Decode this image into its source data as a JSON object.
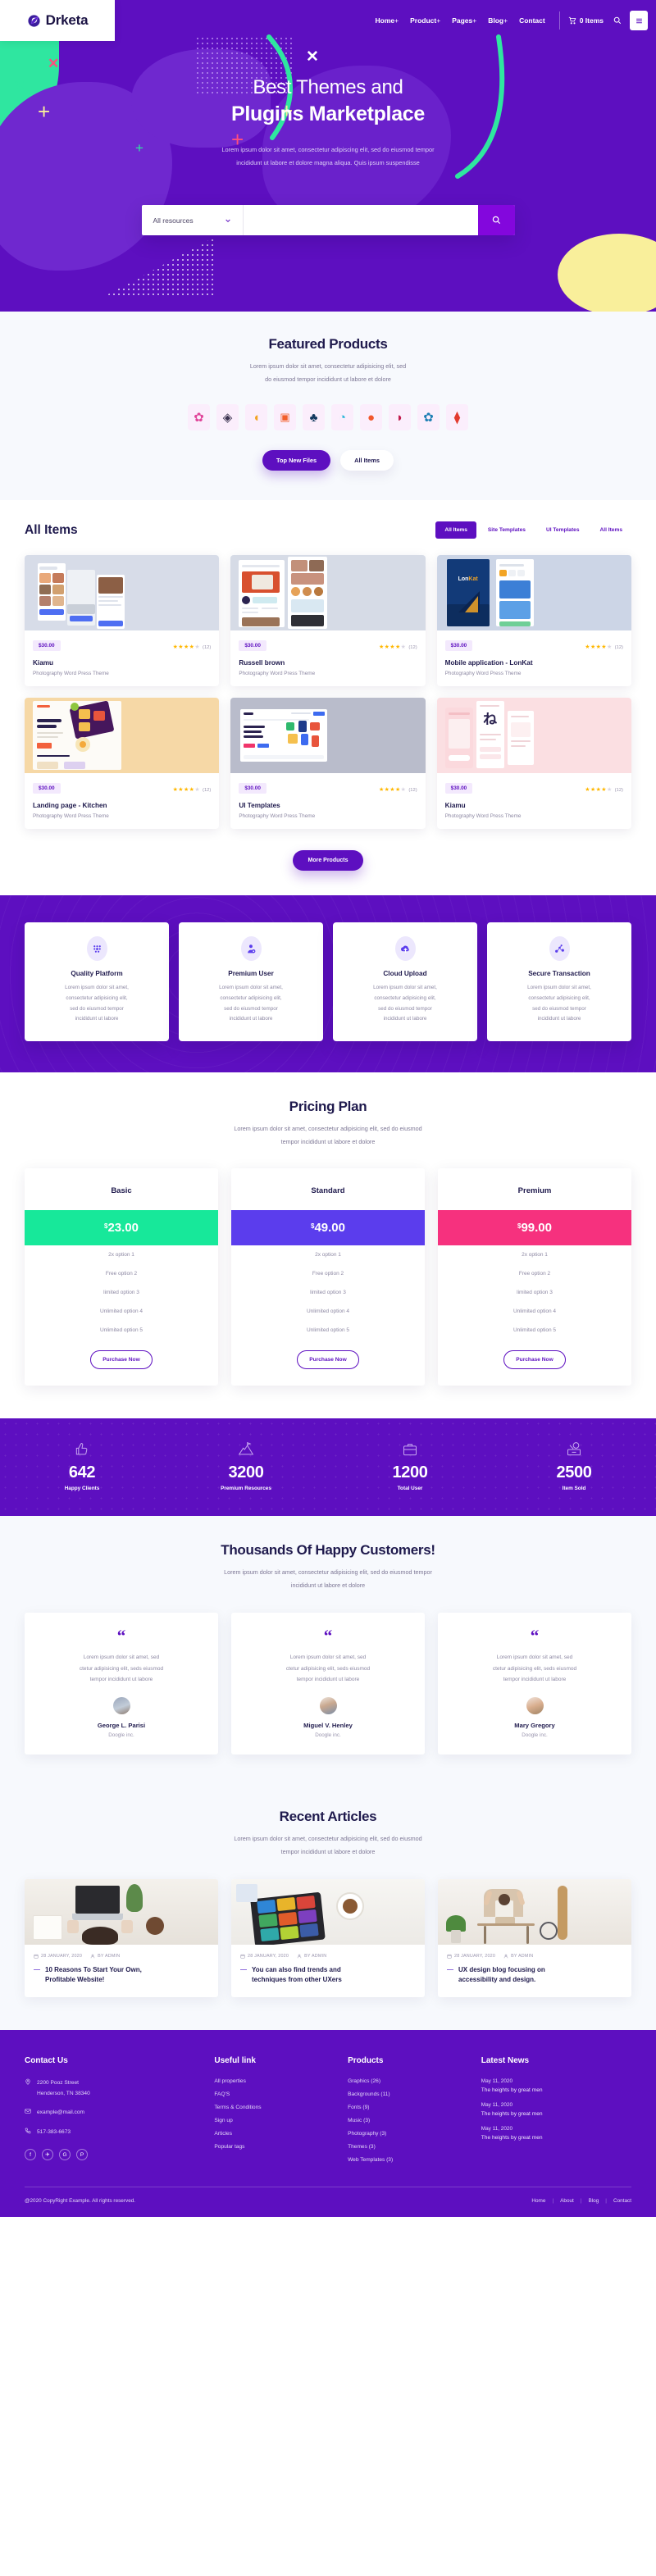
{
  "brand": {
    "name": "Drketa",
    "logo_icon": "leaf-logo-icon"
  },
  "nav": {
    "items": [
      {
        "label": "Home",
        "plus": "+"
      },
      {
        "label": "Product",
        "plus": "+"
      },
      {
        "label": "Pages",
        "plus": "+"
      },
      {
        "label": "Blog",
        "plus": "+"
      },
      {
        "label": "Contact",
        "plus": ""
      }
    ],
    "cart_label": "0 Items",
    "cart_icon": "cart-icon",
    "search_icon": "search-icon",
    "menu_icon": "hamburger-menu-icon"
  },
  "hero": {
    "title_line1": "Best Themes and",
    "title_line2": "Plugins Marketplace",
    "subtitle_line1": "Lorem ipsum dolor sit amet, consectetur adipiscing elit, sed do eiusmod tempor",
    "subtitle_line2": "incididunt ut labore et dolore magna aliqua. Quis ipsum suspendisse",
    "search_select": "All resources",
    "search_placeholder": "",
    "search_value": "",
    "search_button_icon": "search-icon",
    "bg_color": "#5d0fc0"
  },
  "featured": {
    "title": "Featured Products",
    "sub_line1": "Lorem ipsum dolor sit amet, consectetur adipisicing elit, sed",
    "sub_line2": "do eiusmod tempor incididunt ut labore et dolore",
    "brands": [
      {
        "icon": "brand-confetti-icon",
        "glyph": "❁",
        "color": "#e0459a"
      },
      {
        "icon": "brand-diamonds-icon",
        "glyph": "❖",
        "color": "#3b3350"
      },
      {
        "icon": "brand-sun-icon",
        "glyph": "◖",
        "color": "#f2a424"
      },
      {
        "icon": "brand-chat-icon",
        "glyph": "⬛",
        "color": "#f25f2a"
      },
      {
        "icon": "brand-fountain-icon",
        "glyph": "♣",
        "color": "#13395f"
      },
      {
        "icon": "brand-wave-icon",
        "glyph": "◔",
        "color": "#29b6d8"
      },
      {
        "icon": "brand-drop-icon",
        "glyph": "●",
        "color": "#f1582c"
      },
      {
        "icon": "brand-leaf-icon",
        "glyph": "◗",
        "color": "#c11c4d"
      },
      {
        "icon": "brand-feather-icon",
        "glyph": "✿",
        "color": "#1e7fb4"
      },
      {
        "icon": "brand-ribbon-icon",
        "glyph": "⧫",
        "color": "#e23b2f"
      }
    ],
    "btn_primary": "Top New Files",
    "btn_secondary": "All Items"
  },
  "all_items": {
    "title": "All Items",
    "tabs": [
      {
        "label": "All Items",
        "active": true
      },
      {
        "label": "Site Templates",
        "active": false
      },
      {
        "label": "UI Templates",
        "active": false
      },
      {
        "label": "All Items",
        "active": false
      }
    ],
    "products": [
      {
        "price": "$30.00",
        "rating": 4,
        "reviews": "(12)",
        "title": "Kiamu",
        "desc": "Photography Word Press Theme",
        "thumb": "mobile-screens-thumb",
        "bg": "#d7dce8"
      },
      {
        "price": "$30.00",
        "rating": 4,
        "reviews": "(12)",
        "title": "Russell brown",
        "desc": "Photography Word Press Theme",
        "thumb": "web-layout-thumb",
        "bg": "#d6dbe6"
      },
      {
        "price": "$30.00",
        "rating": 4,
        "reviews": "(12)",
        "title": "Mobile application - LonKat",
        "desc": "Photography Word Press Theme",
        "thumb": "lonkat-app-thumb",
        "bg": "#ccd5e6"
      },
      {
        "price": "$30.00",
        "rating": 4,
        "reviews": "(12)",
        "title": "Landing page - Kitchen",
        "desc": "Photography Word Press Theme",
        "thumb": "kitchen-landing-thumb",
        "bg": "#f6d8a6"
      },
      {
        "price": "$30.00",
        "rating": 4,
        "reviews": "(12)",
        "title": "UI Templates",
        "desc": "Photography Word Press Theme",
        "thumb": "ui-templates-thumb",
        "bg": "#b9bccb"
      },
      {
        "price": "$30.00",
        "rating": 4,
        "reviews": "(12)",
        "title": "Kiamu",
        "desc": "Photography Word Press Theme",
        "thumb": "japanese-app-thumb",
        "bg": "#fbdfe2"
      }
    ],
    "more_button": "More Products"
  },
  "features": [
    {
      "icon": "quality-dots-icon",
      "glyph": "⠿",
      "title": "Quality Platform",
      "desc_line1": "Lorem ipsum dolor sit amet,",
      "desc_line2": "consectetur adipisicing elit,",
      "desc_line3": "sed do eiusmod tempor",
      "desc_line4": "incididunt ut labore"
    },
    {
      "icon": "premium-user-icon",
      "glyph": "☻",
      "title": "Premium User",
      "desc_line1": "Lorem ipsum dolor sit amet,",
      "desc_line2": "consectetur adipisicing elit,",
      "desc_line3": "sed do eiusmod tempor",
      "desc_line4": "incididunt ut labore"
    },
    {
      "icon": "cloud-upload-icon",
      "glyph": "☁",
      "title": "Cloud Upload",
      "desc_line1": "Lorem ipsum dolor sit amet,",
      "desc_line2": "consectetur adipisicing elit,",
      "desc_line3": "sed do eiusmod tempor",
      "desc_line4": "incididunt ut labore"
    },
    {
      "icon": "secure-transaction-icon",
      "glyph": "⁂",
      "title": "Secure Transaction",
      "desc_line1": "Lorem ipsum dolor sit amet,",
      "desc_line2": "consectetur adipisicing elit,",
      "desc_line3": "sed do eiusmod tempor",
      "desc_line4": "incididunt ut labore"
    }
  ],
  "pricing": {
    "title": "Pricing Plan",
    "sub_line1": "Lorem ipsum dolor sit amet, consectetur adipisicing elit, sed do eiusmod",
    "sub_line2": "tempor incididunt ut labore et dolore",
    "plans": [
      {
        "name": "Basic",
        "currency": "$",
        "price": "23.00",
        "color": "#17e89a",
        "features": [
          "2x option 1",
          "Free option 2",
          "limited option 3",
          "Unlimited option 4",
          "Unlimited option 5"
        ],
        "button": "Purchase Now"
      },
      {
        "name": "Standard",
        "currency": "$",
        "price": "49.00",
        "color": "#5b3ded",
        "features": [
          "2x option 1",
          "Free option 2",
          "limited option 3",
          "Unlimited option 4",
          "Unlimited option 5"
        ],
        "button": "Purchase Now"
      },
      {
        "name": "Premium",
        "currency": "$",
        "price": "99.00",
        "color": "#f6317e",
        "features": [
          "2x option 1",
          "Free option 2",
          "limited option 3",
          "Unlimited option 4",
          "Unlimited option 5"
        ],
        "button": "Purchase Now"
      }
    ]
  },
  "counters": [
    {
      "icon": "thumbs-up-icon",
      "glyph": "👍",
      "value": "642",
      "label": "Happy Clients"
    },
    {
      "icon": "mountain-flag-icon",
      "glyph": "⛰",
      "value": "3200",
      "label": "Premium Resources"
    },
    {
      "icon": "briefcase-icon",
      "glyph": "💼",
      "value": "1200",
      "label": "Total User"
    },
    {
      "icon": "sold-tag-icon",
      "glyph": "🏷",
      "value": "2500",
      "label": "Item Sold"
    }
  ],
  "testimonials": {
    "title": "Thousands Of Happy Customers!",
    "sub_line1": "Lorem ipsum dolor sit amet, consectetur adipisicing elit, sed do eiusmod tempor",
    "sub_line2": "incididunt ut labore et dolore",
    "items": [
      {
        "quote_icon": "quote-icon",
        "t1": "Lorem ipsum dolor sit amet, sed",
        "t2": "ctetur adipisicing elit, seds eiusmod",
        "t3": "tempor incididunt ut labore",
        "name": "George L. Parisi",
        "company": "Doogle inc.",
        "avatar": "avatar-woman-1"
      },
      {
        "quote_icon": "quote-icon",
        "t1": "Lorem ipsum dolor sit amet, sed",
        "t2": "ctetur adipisicing elit, seds eiusmod",
        "t3": "tempor incididunt ut labore",
        "name": "Miguel V. Henley",
        "company": "Doogle inc.",
        "avatar": "avatar-man-1"
      },
      {
        "quote_icon": "quote-icon",
        "t1": "Lorem ipsum dolor sit amet, sed",
        "t2": "ctetur adipisicing elit, seds eiusmod",
        "t3": "tempor incididunt ut labore",
        "name": "Mary Gregory",
        "company": "Doogle inc.",
        "avatar": "avatar-woman-2"
      }
    ]
  },
  "articles": {
    "title": "Recent Articles",
    "sub_line1": "Lorem ipsum dolor sit amet, consectetur adipisicing elit, sed do eiusmod",
    "sub_line2": "tempor incididunt ut labore et dolore",
    "posts": [
      {
        "date": "28 JANUARY, 2020",
        "author": "BY ADMIN",
        "title_l1": "10 Reasons To Start Your Own,",
        "title_l2": "Profitable Website!",
        "img": "laptop-desk-photo"
      },
      {
        "date": "28 JANUARY, 2020",
        "author": "BY ADMIN",
        "title_l1": "You can also find trends and",
        "title_l2": "techniques from other UXers",
        "img": "tablet-coffee-photo"
      },
      {
        "date": "28 JANUARY, 2020",
        "author": "BY ADMIN",
        "title_l1": "UX design blog focusing on",
        "title_l2": "accessibility and design.",
        "img": "woman-desk-photo"
      }
    ],
    "date_icon": "calendar-icon",
    "author_icon": "user-icon"
  },
  "footer": {
    "contact": {
      "heading": "Contact Us",
      "address_l1": "2200 Pooz Street",
      "address_l2": "Henderson, TN 38340",
      "email": "example@mail.com",
      "phone": "517-383-6673",
      "location_icon": "location-pin-icon",
      "mail_icon": "envelope-icon",
      "phone_icon": "phone-icon",
      "socials": [
        {
          "icon": "facebook-icon",
          "glyph": "f"
        },
        {
          "icon": "twitter-icon",
          "glyph": "✈"
        },
        {
          "icon": "google-plus-icon",
          "glyph": "G"
        },
        {
          "icon": "pinterest-icon",
          "glyph": "P"
        }
      ]
    },
    "useful": {
      "heading": "Useful link",
      "links": [
        "All properties",
        "FAQ'S",
        "Terms & Conditions",
        "Sign up",
        "Articles",
        "Popular tags"
      ]
    },
    "products": {
      "heading": "Products",
      "links": [
        "Graphics (26)",
        "Backgrounds (11)",
        "Fonts (9)",
        "Music (3)",
        "Photography (3)",
        "Themes (3)",
        "Web Templates (3)"
      ]
    },
    "news": {
      "heading": "Latest News",
      "items": [
        {
          "date": "May 11, 2020",
          "title": "The heights by great men"
        },
        {
          "date": "May 11, 2020",
          "title": "The heights by great men"
        },
        {
          "date": "May 11, 2020",
          "title": "The heights by great men"
        }
      ]
    },
    "copyright": "@2020 CopyRight Example. All rights reserved.",
    "bottom_links": [
      "Home",
      "About",
      "Blog",
      "Contact"
    ]
  }
}
